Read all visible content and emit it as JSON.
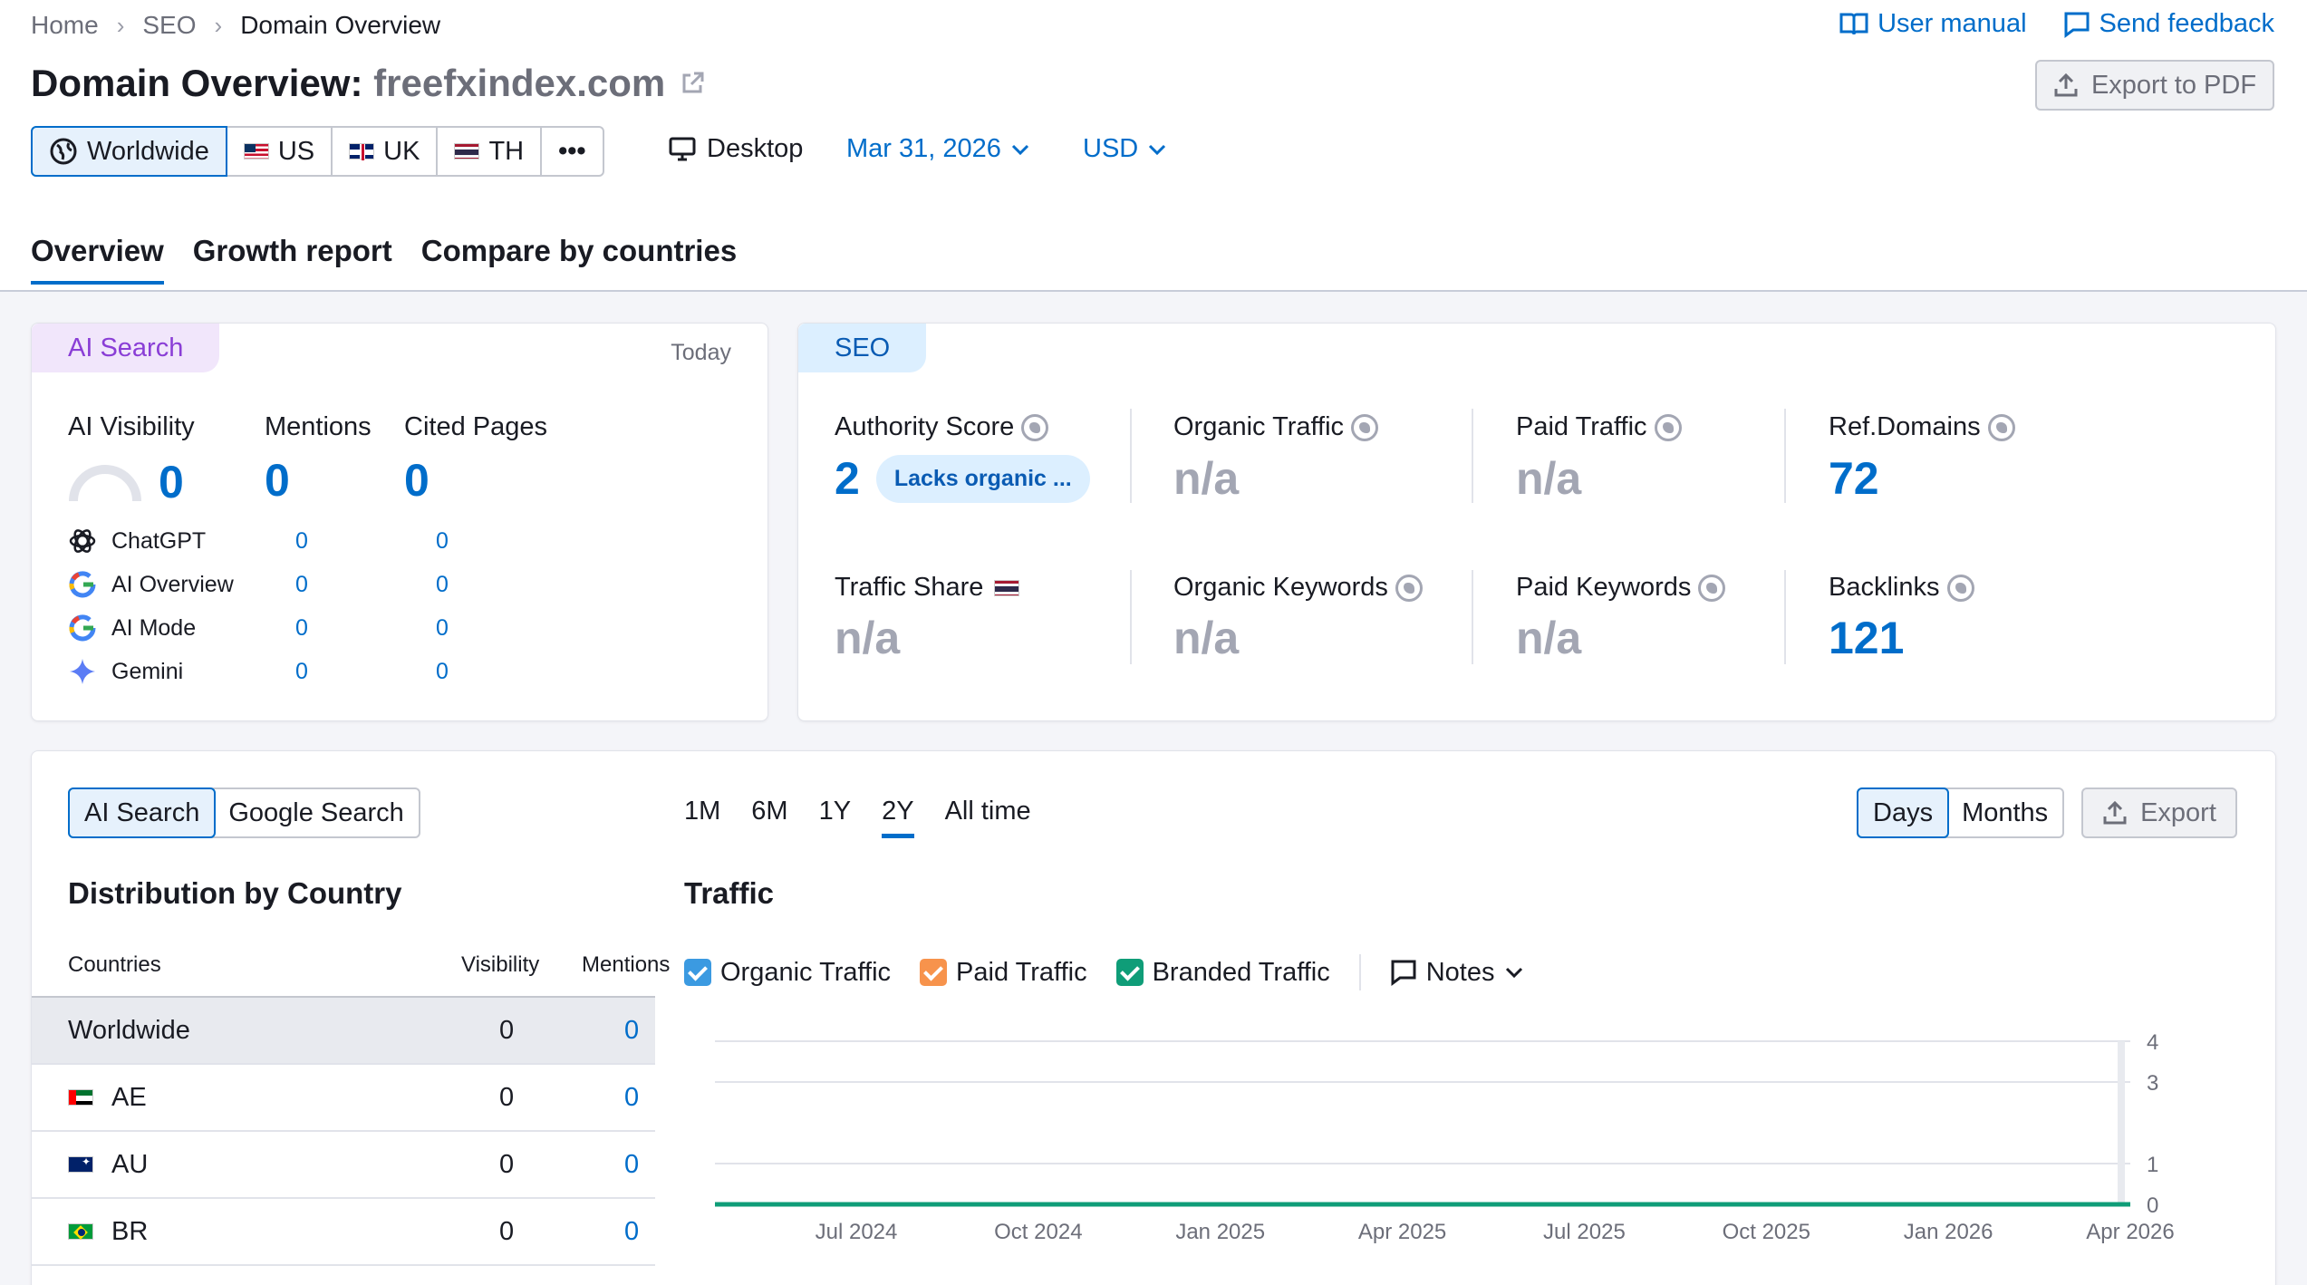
{
  "breadcrumb": {
    "home": "Home",
    "section": "SEO",
    "current": "Domain Overview"
  },
  "top_links": {
    "user_manual": "User manual",
    "send_feedback": "Send feedback"
  },
  "title": {
    "prefix": "Domain Overview:",
    "domain": "freefxindex.com"
  },
  "export_pdf": "Export to PDF",
  "databases": {
    "worldwide": "Worldwide",
    "us": "US",
    "uk": "UK",
    "th": "TH",
    "more": "•••"
  },
  "device": "Desktop",
  "date": "Mar 31, 2026",
  "currency": "USD",
  "tabs": [
    "Overview",
    "Growth report",
    "Compare by countries"
  ],
  "ai_card": {
    "chip": "AI Search",
    "today": "Today",
    "visibility_label": "AI Visibility",
    "visibility_value": "0",
    "mentions_label": "Mentions",
    "mentions_value": "0",
    "cited_label": "Cited Pages",
    "cited_value": "0",
    "sources": [
      {
        "name": "ChatGPT",
        "icon": "chatgpt-icon",
        "mentions": "0",
        "cited": "0"
      },
      {
        "name": "AI Overview",
        "icon": "google-icon",
        "mentions": "0",
        "cited": "0"
      },
      {
        "name": "AI Mode",
        "icon": "google-icon",
        "mentions": "0",
        "cited": "0"
      },
      {
        "name": "Gemini",
        "icon": "gemini-icon",
        "mentions": "0",
        "cited": "0"
      }
    ]
  },
  "seo_card": {
    "chip": "SEO",
    "authority_label": "Authority Score",
    "authority_value": "2",
    "authority_badge": "Lacks organic ...",
    "organic_traffic_label": "Organic Traffic",
    "organic_traffic_value": "n/a",
    "paid_traffic_label": "Paid Traffic",
    "paid_traffic_value": "n/a",
    "ref_domains_label": "Ref.Domains",
    "ref_domains_value": "72",
    "traffic_share_label": "Traffic Share",
    "traffic_share_value": "n/a",
    "organic_keywords_label": "Organic Keywords",
    "organic_keywords_value": "n/a",
    "paid_keywords_label": "Paid Keywords",
    "paid_keywords_value": "n/a",
    "backlinks_label": "Backlinks",
    "backlinks_value": "121"
  },
  "bottom": {
    "search_toggle": {
      "ai": "AI Search",
      "google": "Google Search"
    },
    "distribution_title": "Distribution by Country",
    "table_headers": {
      "countries": "Countries",
      "visibility": "Visibility",
      "mentions": "Mentions"
    },
    "rows": [
      {
        "country": "Worldwide",
        "visibility": "0",
        "mentions": "0"
      },
      {
        "country": "AE",
        "visibility": "0",
        "mentions": "0"
      },
      {
        "country": "AU",
        "visibility": "0",
        "mentions": "0"
      },
      {
        "country": "BR",
        "visibility": "0",
        "mentions": "0"
      }
    ],
    "periods": [
      "1M",
      "6M",
      "1Y",
      "2Y",
      "All time"
    ],
    "active_period": "2Y",
    "traffic_title": "Traffic",
    "granularity": {
      "days": "Days",
      "months": "Months"
    },
    "export": "Export",
    "legend": {
      "organic": "Organic Traffic",
      "paid": "Paid Traffic",
      "branded": "Branded Traffic",
      "notes": "Notes"
    },
    "colors": {
      "organic": "#3b9ae1",
      "paid": "#f7934c",
      "branded": "#0f9d78",
      "accent": "#006dca"
    }
  },
  "chart_data": {
    "type": "line",
    "x": [
      "Jul 2024",
      "Oct 2024",
      "Jan 2025",
      "Apr 2025",
      "Jul 2025",
      "Oct 2025",
      "Jan 2026",
      "Apr 2026"
    ],
    "yticks": [
      "4",
      "3",
      "1",
      "0"
    ],
    "ylim": [
      0,
      4
    ],
    "series": [
      {
        "name": "Branded Traffic",
        "values": [
          0,
          0,
          0,
          0,
          0,
          0,
          0,
          0
        ]
      }
    ]
  }
}
